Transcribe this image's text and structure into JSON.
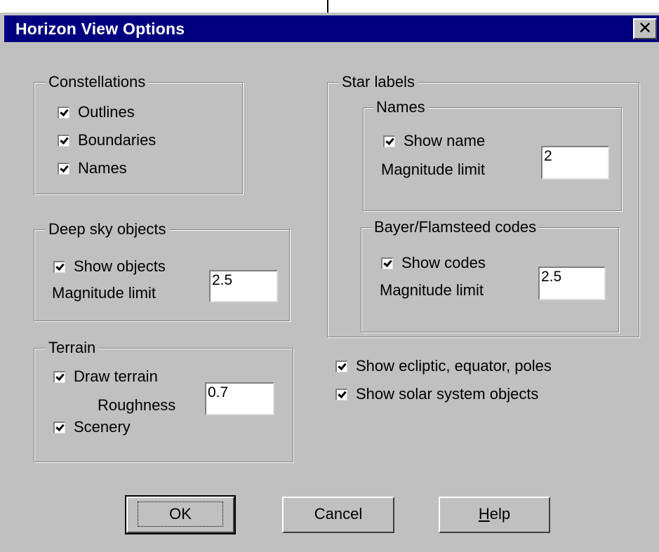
{
  "window": {
    "title": "Horizon View Options",
    "close_glyph": "✕"
  },
  "constellations": {
    "title": "Constellations",
    "outlines": "Outlines",
    "boundaries": "Boundaries",
    "names": "Names"
  },
  "deep_sky": {
    "title": "Deep sky objects",
    "show": "Show objects",
    "mag_label": "Magnitude limit",
    "mag_value": "2.5"
  },
  "terrain": {
    "title": "Terrain",
    "draw": "Draw terrain",
    "rough_label": "Roughness",
    "rough_value": "0.7",
    "scenery": "Scenery"
  },
  "star_labels": {
    "title": "Star labels",
    "names": {
      "title": "Names",
      "show": "Show name",
      "mag_label": "Magnitude limit",
      "mag_value": "2"
    },
    "codes": {
      "title": "Bayer/Flamsteed codes",
      "show": "Show codes",
      "mag_label": "Magnitude limit",
      "mag_value": "2.5"
    }
  },
  "misc": {
    "ecliptic": "Show ecliptic, equator, poles",
    "solar": "Show solar system objects"
  },
  "buttons": {
    "ok": "OK",
    "cancel": "Cancel",
    "help_first": "H",
    "help_rest": "elp"
  }
}
